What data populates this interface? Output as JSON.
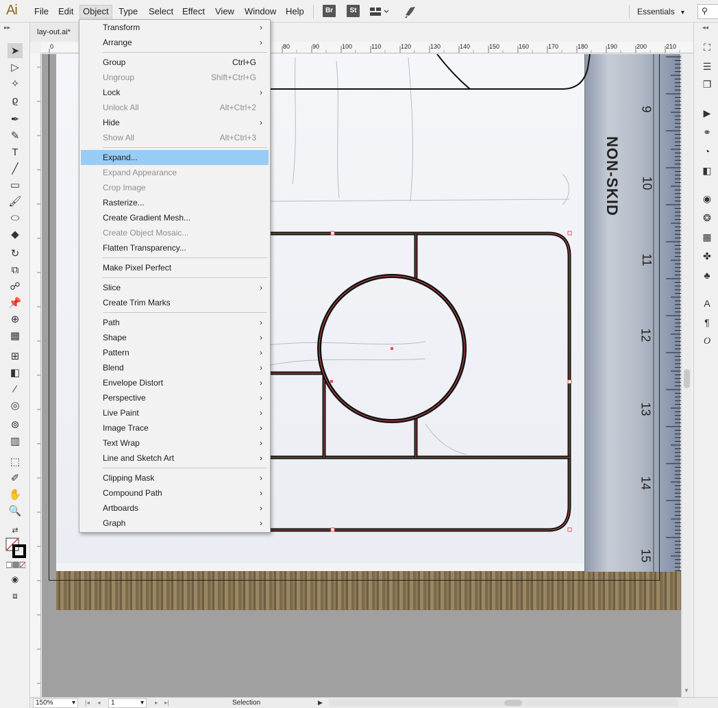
{
  "app": {
    "logo": "Ai"
  },
  "menubar": {
    "items": [
      "File",
      "Edit",
      "Object",
      "Type",
      "Select",
      "Effect",
      "View",
      "Window",
      "Help"
    ],
    "active": "Object",
    "bridge": "Br",
    "stock": "St",
    "workspace": "Essentials"
  },
  "document": {
    "tab_title": "lay-out.ai*"
  },
  "ruler": {
    "top_ticks": [
      "0",
      "80",
      "90",
      "100",
      "110",
      "120",
      "130",
      "140",
      "150",
      "160",
      "170",
      "180",
      "190",
      "200",
      "210"
    ]
  },
  "object_menu": {
    "items": [
      {
        "label": "Transform",
        "submenu": true
      },
      {
        "label": "Arrange",
        "submenu": true
      },
      {
        "label": "Group",
        "shortcut": "Ctrl+G"
      },
      {
        "label": "Ungroup",
        "shortcut": "Shift+Ctrl+G",
        "disabled": true
      },
      {
        "label": "Lock",
        "submenu": true
      },
      {
        "label": "Unlock All",
        "shortcut": "Alt+Ctrl+2",
        "disabled": true
      },
      {
        "label": "Hide",
        "submenu": true
      },
      {
        "label": "Show All",
        "shortcut": "Alt+Ctrl+3",
        "disabled": true
      },
      {
        "label": "Expand...",
        "highlighted": true
      },
      {
        "label": "Expand Appearance",
        "disabled": true
      },
      {
        "label": "Crop Image",
        "disabled": true
      },
      {
        "label": "Rasterize..."
      },
      {
        "label": "Create Gradient Mesh..."
      },
      {
        "label": "Create Object Mosaic...",
        "disabled": true
      },
      {
        "label": "Flatten Transparency..."
      },
      {
        "label": "Make Pixel Perfect"
      },
      {
        "label": "Slice",
        "submenu": true
      },
      {
        "label": "Create Trim Marks"
      },
      {
        "label": "Path",
        "submenu": true
      },
      {
        "label": "Shape",
        "submenu": true
      },
      {
        "label": "Pattern",
        "submenu": true
      },
      {
        "label": "Blend",
        "submenu": true
      },
      {
        "label": "Envelope Distort",
        "submenu": true
      },
      {
        "label": "Perspective",
        "submenu": true
      },
      {
        "label": "Live Paint",
        "submenu": true
      },
      {
        "label": "Image Trace",
        "submenu": true
      },
      {
        "label": "Text Wrap",
        "submenu": true
      },
      {
        "label": "Line and Sketch Art",
        "submenu": true
      },
      {
        "label": "Clipping Mask",
        "submenu": true
      },
      {
        "label": "Compound Path",
        "submenu": true
      },
      {
        "label": "Artboards",
        "submenu": true
      },
      {
        "label": "Graph",
        "submenu": true
      }
    ]
  },
  "photo": {
    "ruler_text": "NON-SKID",
    "ruler_numbers": [
      "9",
      "10",
      "11",
      "12",
      "13",
      "14",
      "15"
    ]
  },
  "statusbar": {
    "zoom": "150%",
    "page": "1",
    "tool": "Selection"
  },
  "colors": {
    "highlight": "#99ccf5",
    "selection": "#e05050"
  }
}
